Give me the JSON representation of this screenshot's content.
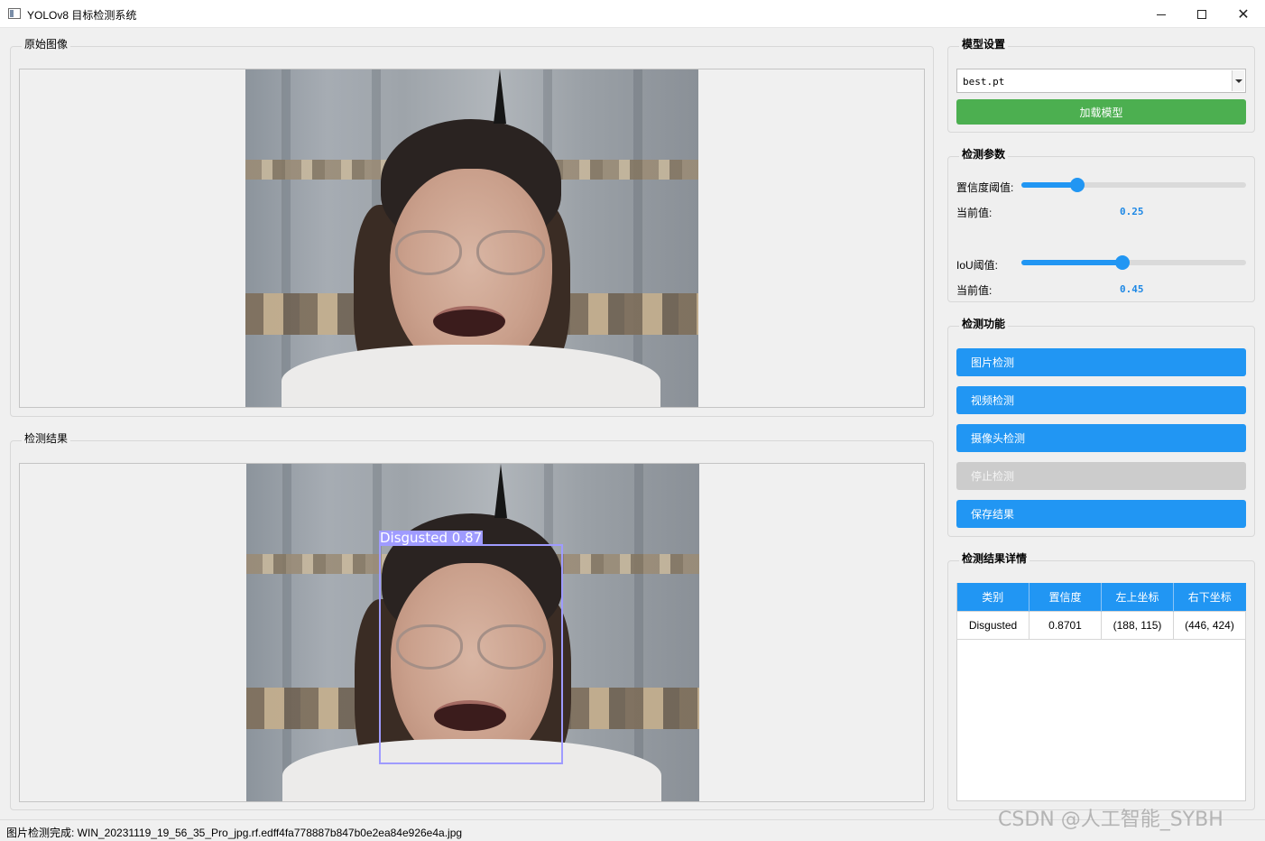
{
  "window": {
    "title": "YOLOv8 目标检测系统",
    "minimize": "—",
    "close": "✕"
  },
  "original_image": {
    "title": "原始图像"
  },
  "result_image": {
    "title": "检测结果",
    "detection_label": "Disgusted  0.87",
    "bbox_color": "#9f9bff"
  },
  "model_settings": {
    "title": "模型设置",
    "model_selected": "best.pt",
    "load_button": "加载模型"
  },
  "detection_params": {
    "title": "检测参数",
    "confidence_label": "置信度阈值:",
    "confidence_current_label": "当前值:",
    "confidence_value": "0.25",
    "confidence_fraction": 0.25,
    "iou_label": "IoU阈值:",
    "iou_current_label": "当前值:",
    "iou_value": "0.45",
    "iou_fraction": 0.45
  },
  "detection_functions": {
    "title": "检测功能",
    "image_detect": "图片检测",
    "video_detect": "视频检测",
    "camera_detect": "摄像头检测",
    "stop_detect": "停止检测",
    "save_results": "保存结果"
  },
  "details": {
    "title": "检测结果详情",
    "columns": [
      "类别",
      "置信度",
      "左上坐标",
      "右下坐标"
    ],
    "rows": [
      [
        "Disgusted",
        "0.8701",
        "(188, 115)",
        "(446, 424)"
      ]
    ]
  },
  "status": {
    "text": "图片检测完成: WIN_20231119_19_56_35_Pro_jpg.rf.edff4fa778887b847b0e2ea84e926e4a.jpg"
  },
  "watermark": "CSDN @人工智能_SYBH",
  "colors": {
    "accent": "#2196f3",
    "load_button": "#4caf50",
    "disabled": "#cccccc"
  }
}
